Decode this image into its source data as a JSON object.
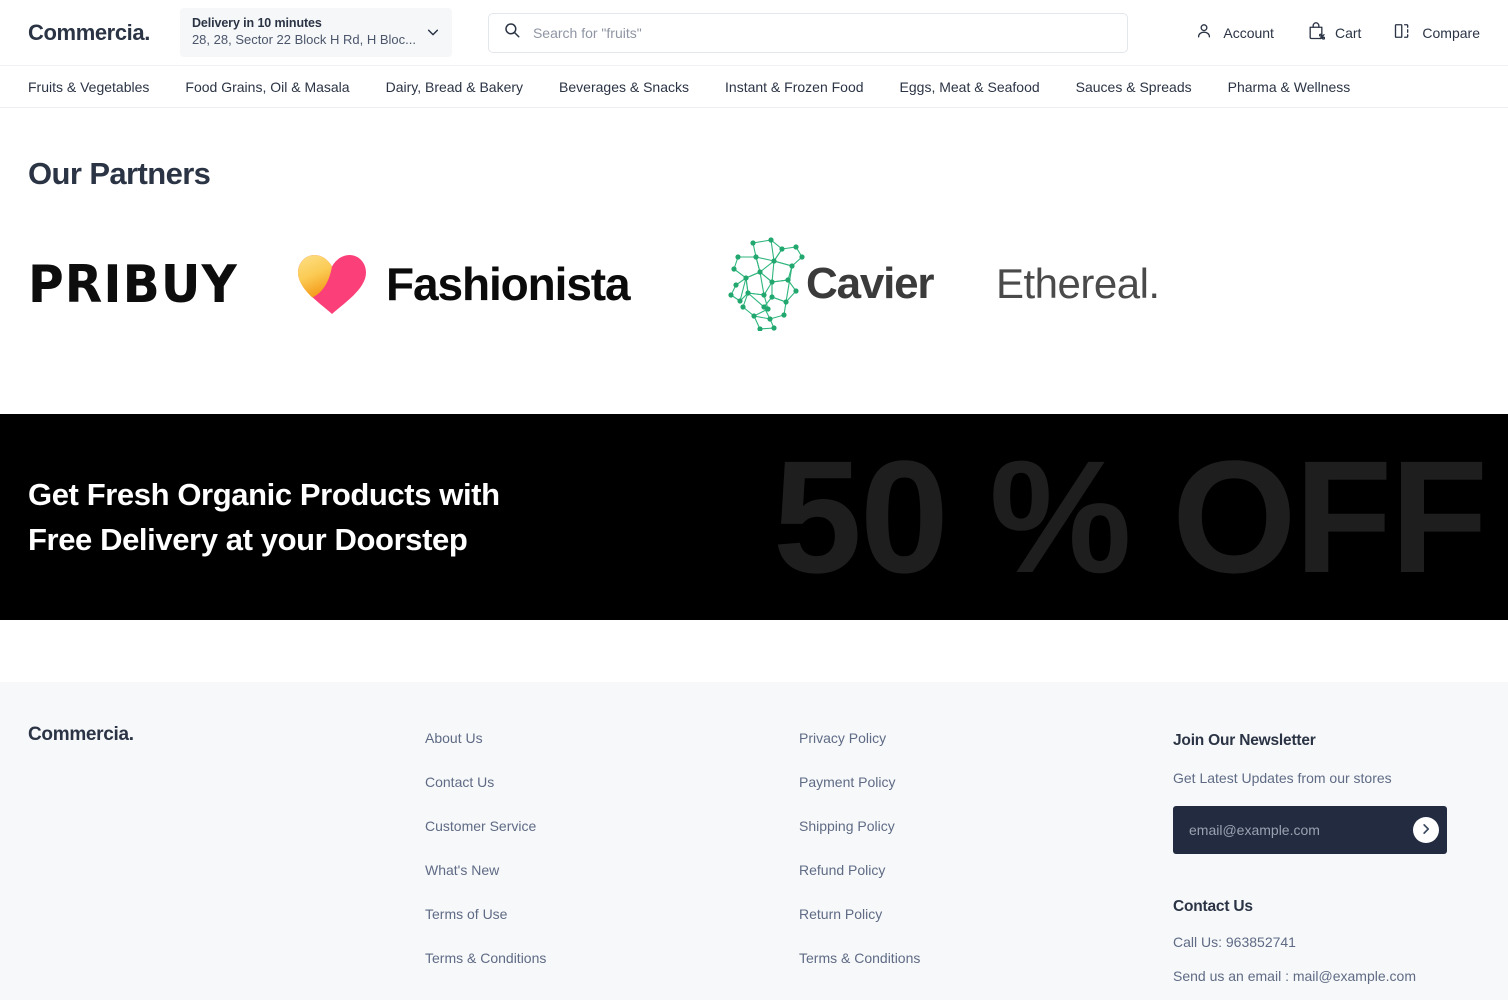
{
  "header": {
    "brand": "Commercia.",
    "delivery": {
      "title": "Delivery in 10 minutes",
      "address": "28, 28, Sector 22 Block H Rd, H Bloc...",
      "chevron_icon": "chevron-down-icon"
    },
    "search": {
      "placeholder": "Search for \"fruits\"",
      "value": "",
      "icon": "search-icon"
    },
    "actions": [
      {
        "label": "Account",
        "icon": "user-icon"
      },
      {
        "label": "Cart",
        "icon": "shopping-bag-percent-icon"
      },
      {
        "label": "Compare",
        "icon": "compare-icon"
      }
    ]
  },
  "nav": {
    "items": [
      {
        "label": "Fruits & Vegetables"
      },
      {
        "label": "Food Grains, Oil & Masala"
      },
      {
        "label": "Dairy, Bread & Bakery"
      },
      {
        "label": "Beverages & Snacks"
      },
      {
        "label": "Instant & Frozen Food"
      },
      {
        "label": "Eggs, Meat & Seafood"
      },
      {
        "label": "Sauces & Spreads"
      },
      {
        "label": "Pharma & Wellness"
      }
    ]
  },
  "partners": {
    "title": "Our Partners",
    "items": [
      {
        "name": "PRIBUY",
        "type": "wordmark"
      },
      {
        "name": "Fashionista",
        "type": "heart-logo",
        "colors": {
          "left": "#fbd25e",
          "left_dark": "#f5a623",
          "right": "#fb3f79"
        }
      },
      {
        "name": "Cavier",
        "type": "network-logo",
        "colors": {
          "net": "#25b377",
          "text": "#3b3b3b"
        }
      },
      {
        "name": "Ethereal.",
        "type": "wordmark"
      }
    ]
  },
  "promo": {
    "headline_line1": "Get Fresh Organic Products with",
    "headline_line2": "Free Delivery at your Doorstep",
    "background_text": "50 % OFF",
    "background_color": "#000000",
    "background_text_color": "#1e1e1e"
  },
  "footer": {
    "brand": "Commercia.",
    "link_columns": [
      {
        "links": [
          "About Us",
          "Contact Us",
          "Customer Service",
          "What's New",
          "Terms of Use",
          "Terms & Conditions"
        ]
      },
      {
        "links": [
          "Privacy Policy",
          "Payment Policy",
          "Shipping Policy",
          "Refund Policy",
          "Return Policy",
          "Terms & Conditions"
        ]
      }
    ],
    "newsletter": {
      "heading": "Join Our Newsletter",
      "subheading": "Get Latest Updates from our stores",
      "placeholder": "email@example.com",
      "value": "",
      "submit_icon": "chevron-right-icon"
    },
    "contact": {
      "heading": "Contact Us",
      "phone": "Call Us: 963852741",
      "email": "Send us an email : mail@example.com"
    }
  }
}
